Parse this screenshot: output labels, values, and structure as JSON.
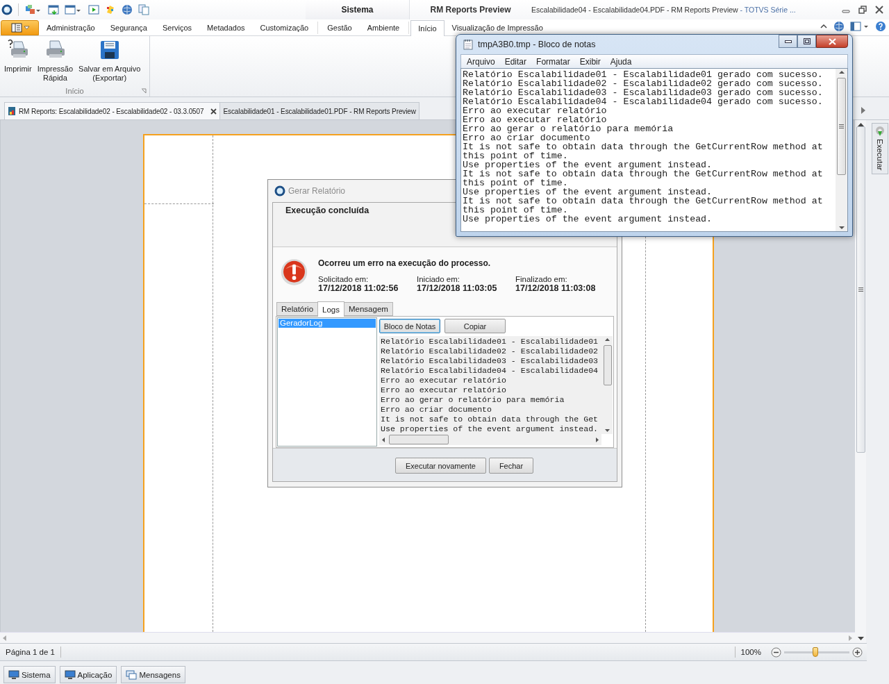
{
  "title_bar": {
    "context_title": "Sistema",
    "app_title": "RM Reports Preview",
    "document_title": "Escalabilidade04 - Escalabilidade04.PDF - RM Reports Preview",
    "product": " - TOTVS Série ..."
  },
  "ribbon": {
    "tabs": [
      {
        "label": "Administração",
        "selected": false
      },
      {
        "label": "Segurança",
        "selected": false
      },
      {
        "label": "Serviços",
        "selected": false
      },
      {
        "label": "Metadados",
        "selected": false
      },
      {
        "label": "Customização",
        "selected": false
      },
      {
        "label": "Gestão",
        "selected": false
      },
      {
        "label": "Ambiente",
        "selected": false
      },
      {
        "label": "Início",
        "selected": true
      },
      {
        "label": "Visualização de Impressão",
        "selected": false
      }
    ],
    "group": {
      "label": "Início",
      "buttons": [
        {
          "label": "Imprimir",
          "kind": "print-help"
        },
        {
          "label": "Impressão\nRápida",
          "kind": "print"
        },
        {
          "label": "Salvar em Arquivo\n(Exportar)",
          "kind": "save"
        }
      ]
    }
  },
  "document_tabs": [
    {
      "label": "RM Reports: Escalabilidade02 - Escalabilidade02 - 03.3.0507",
      "selected": true
    },
    {
      "label": "Escalabilidade01 - Escalabilidade01.PDF - RM Reports Preview",
      "selected": false
    }
  ],
  "side_panel": {
    "label": "Executar"
  },
  "status_bar": {
    "page": "Página 1 de 1",
    "zoom": "100%",
    "zoom_slider": {
      "level": 0.48
    }
  },
  "bottom_tabs": [
    {
      "label": "Sistema",
      "kind": "computer"
    },
    {
      "label": "Aplicação",
      "kind": "computer"
    },
    {
      "label": "Mensagens",
      "kind": "messages"
    }
  ],
  "dialog": {
    "title": "Gerar Relatório",
    "header": "Execução concluída",
    "message": "Ocorreu um erro na execução do processo.",
    "times": [
      {
        "label": "Solicitado em:",
        "value": "17/12/2018 11:02:56"
      },
      {
        "label": "Iniciado em:",
        "value": "17/12/2018 11:03:05"
      },
      {
        "label": "Finalizado em:",
        "value": "17/12/2018 11:03:08"
      }
    ],
    "tabs": [
      {
        "label": "Relatório",
        "selected": false
      },
      {
        "label": "Logs",
        "selected": true
      },
      {
        "label": "Mensagem",
        "selected": false
      }
    ],
    "log_list": [
      {
        "label": "GeradorLog",
        "selected": true
      }
    ],
    "buttons": [
      {
        "label": "Bloco de Notas",
        "focused": true
      },
      {
        "label": "Copiar",
        "focused": false
      }
    ],
    "log_lines": [
      "Relatório Escalabilidade01 - Escalabilidade01",
      "Relatório Escalabilidade02 - Escalabilidade02",
      "Relatório Escalabilidade03 - Escalabilidade03",
      "Relatório Escalabilidade04 - Escalabilidade04",
      "Erro ao executar relatório",
      "Erro ao executar relatório",
      "Erro ao gerar o relatório para memória",
      "Erro ao criar documento",
      "It is not safe to obtain data through the Get",
      "Use properties of the event argument instead."
    ],
    "footer_buttons": [
      "Executar novamente",
      "Fechar"
    ]
  },
  "notepad": {
    "title": "tmpA3B0.tmp - Bloco de notas",
    "menu": [
      "Arquivo",
      "Editar",
      "Formatar",
      "Exibir",
      "Ajuda"
    ],
    "lines": [
      "Relatório Escalabilidade01 - Escalabilidade01 gerado com sucesso.",
      "Relatório Escalabilidade02 - Escalabilidade02 gerado com sucesso.",
      "Relatório Escalabilidade03 - Escalabilidade03 gerado com sucesso.",
      "Relatório Escalabilidade04 - Escalabilidade04 gerado com sucesso.",
      "Erro ao executar relatório",
      "Erro ao executar relatório",
      "Erro ao gerar o relatório para memória",
      "Erro ao criar documento",
      "It is not safe to obtain data through the GetCurrentRow method at",
      "this point of time.",
      "Use properties of the event argument instead.",
      "It is not safe to obtain data through the GetCurrentRow method at",
      "this point of time.",
      "Use properties of the event argument instead.",
      "It is not safe to obtain data through the GetCurrentRow method at",
      "this point of time.",
      "Use properties of the event argument instead."
    ]
  }
}
